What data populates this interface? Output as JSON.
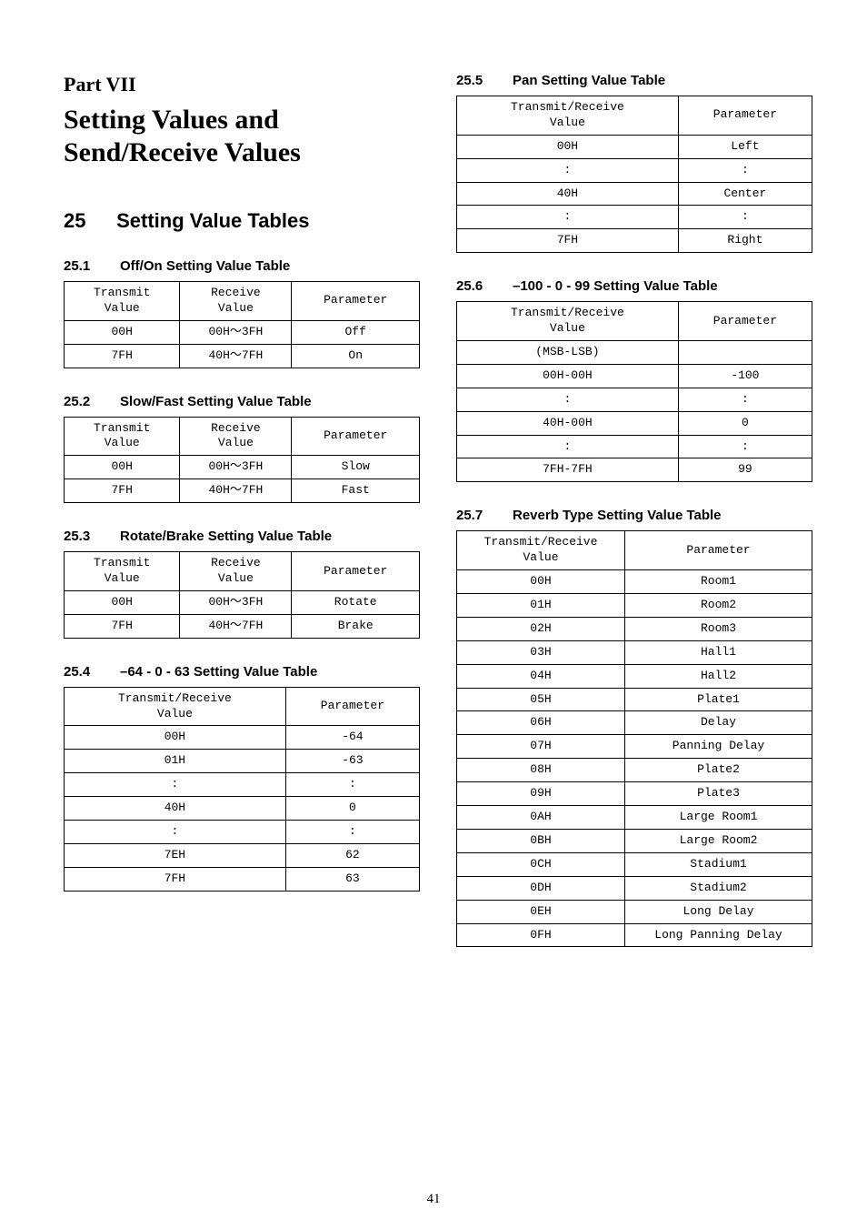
{
  "part": {
    "label": "Part VII",
    "title": "Setting Values and Send/Receive Values"
  },
  "section": {
    "num": "25",
    "title": "Setting Value Tables"
  },
  "subsections": {
    "s1": {
      "num": "25.1",
      "title": "Off/On Setting Value Table"
    },
    "s2": {
      "num": "25.2",
      "title": "Slow/Fast Setting Value Table"
    },
    "s3": {
      "num": "25.3",
      "title": "Rotate/Brake Setting Value Table"
    },
    "s4": {
      "num": "25.4",
      "title": "–64 - 0 - 63 Setting Value Table"
    },
    "s5": {
      "num": "25.5",
      "title": "Pan Setting Value Table"
    },
    "s6": {
      "num": "25.6",
      "title": "–100 - 0 - 99 Setting Value Table"
    },
    "s7": {
      "num": "25.7",
      "title": "Reverb Type Setting Value Table"
    }
  },
  "headers": {
    "transmit": "Transmit\nValue",
    "receive": "Receive\nValue",
    "tr": "Transmit/Receive\nValue",
    "param": "Parameter"
  },
  "t1": {
    "r0": {
      "c0": "00H",
      "c1": "00H～3FH",
      "c2": "Off"
    },
    "r1": {
      "c0": "7FH",
      "c1": "40H～7FH",
      "c2": "On"
    }
  },
  "t2": {
    "r0": {
      "c0": "00H",
      "c1": "00H～3FH",
      "c2": "Slow"
    },
    "r1": {
      "c0": "7FH",
      "c1": "40H～7FH",
      "c2": "Fast"
    }
  },
  "t3": {
    "r0": {
      "c0": "00H",
      "c1": "00H～3FH",
      "c2": "Rotate"
    },
    "r1": {
      "c0": "7FH",
      "c1": "40H～7FH",
      "c2": "Brake"
    }
  },
  "t4": {
    "r0": {
      "c0": "00H",
      "c1": "-64"
    },
    "r1": {
      "c0": "01H",
      "c1": "-63"
    },
    "r2": {
      "c0": ":",
      "c1": ":"
    },
    "r3": {
      "c0": "40H",
      "c1": "0"
    },
    "r4": {
      "c0": ":",
      "c1": ":"
    },
    "r5": {
      "c0": "7EH",
      "c1": "62"
    },
    "r6": {
      "c0": "7FH",
      "c1": "63"
    }
  },
  "t5": {
    "r0": {
      "c0": "00H",
      "c1": "Left"
    },
    "r1": {
      "c0": ":",
      "c1": ":"
    },
    "r2": {
      "c0": "40H",
      "c1": "Center"
    },
    "r3": {
      "c0": ":",
      "c1": ":"
    },
    "r4": {
      "c0": "7FH",
      "c1": "Right"
    }
  },
  "t6": {
    "r0": {
      "c0": "(MSB-LSB)",
      "c1": ""
    },
    "r1": {
      "c0": "00H-00H",
      "c1": "-100"
    },
    "r2": {
      "c0": ":",
      "c1": ":"
    },
    "r3": {
      "c0": "40H-00H",
      "c1": "0"
    },
    "r4": {
      "c0": ":",
      "c1": ":"
    },
    "r5": {
      "c0": "7FH-7FH",
      "c1": "99"
    }
  },
  "t7": {
    "r0": {
      "c0": "00H",
      "c1": "Room1"
    },
    "r1": {
      "c0": "01H",
      "c1": "Room2"
    },
    "r2": {
      "c0": "02H",
      "c1": "Room3"
    },
    "r3": {
      "c0": "03H",
      "c1": "Hall1"
    },
    "r4": {
      "c0": "04H",
      "c1": "Hall2"
    },
    "r5": {
      "c0": "05H",
      "c1": "Plate1"
    },
    "r6": {
      "c0": "06H",
      "c1": "Delay"
    },
    "r7": {
      "c0": "07H",
      "c1": "Panning Delay"
    },
    "r8": {
      "c0": "08H",
      "c1": "Plate2"
    },
    "r9": {
      "c0": "09H",
      "c1": "Plate3"
    },
    "r10": {
      "c0": "0AH",
      "c1": "Large Room1"
    },
    "r11": {
      "c0": "0BH",
      "c1": "Large Room2"
    },
    "r12": {
      "c0": "0CH",
      "c1": "Stadium1"
    },
    "r13": {
      "c0": "0DH",
      "c1": "Stadium2"
    },
    "r14": {
      "c0": "0EH",
      "c1": "Long Delay"
    },
    "r15": {
      "c0": "0FH",
      "c1": "Long Panning Delay"
    }
  },
  "pageNumber": "41"
}
